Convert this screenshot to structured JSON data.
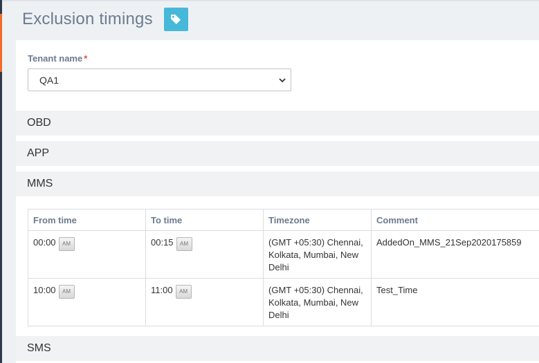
{
  "page": {
    "title": "Exclusion timings",
    "tag_icon": "tag-icon",
    "accent_color": "#46b8da"
  },
  "tenant": {
    "label": "Tenant name",
    "required_mark": "*",
    "selected": "QA1"
  },
  "sections": [
    {
      "label": "OBD"
    },
    {
      "label": "APP"
    },
    {
      "label": "MMS"
    },
    {
      "label": "SMS"
    }
  ],
  "mms_table": {
    "headers": [
      "From time",
      "To time",
      "Timezone",
      "Comment"
    ],
    "rows": [
      {
        "from_time": "00:00",
        "from_period": "AM",
        "to_time": "00:15",
        "to_period": "AM",
        "timezone": "(GMT +05:30) Chennai, Kolkata, Mumbai, New Delhi",
        "comment": "AddedOn_MMS_21Sep2020175859"
      },
      {
        "from_time": "10:00",
        "from_period": "AM",
        "to_time": "11:00",
        "to_period": "AM",
        "timezone": "(GMT +05:30) Chennai, Kolkata, Mumbai, New Delhi",
        "comment": "Test_Time"
      }
    ]
  }
}
